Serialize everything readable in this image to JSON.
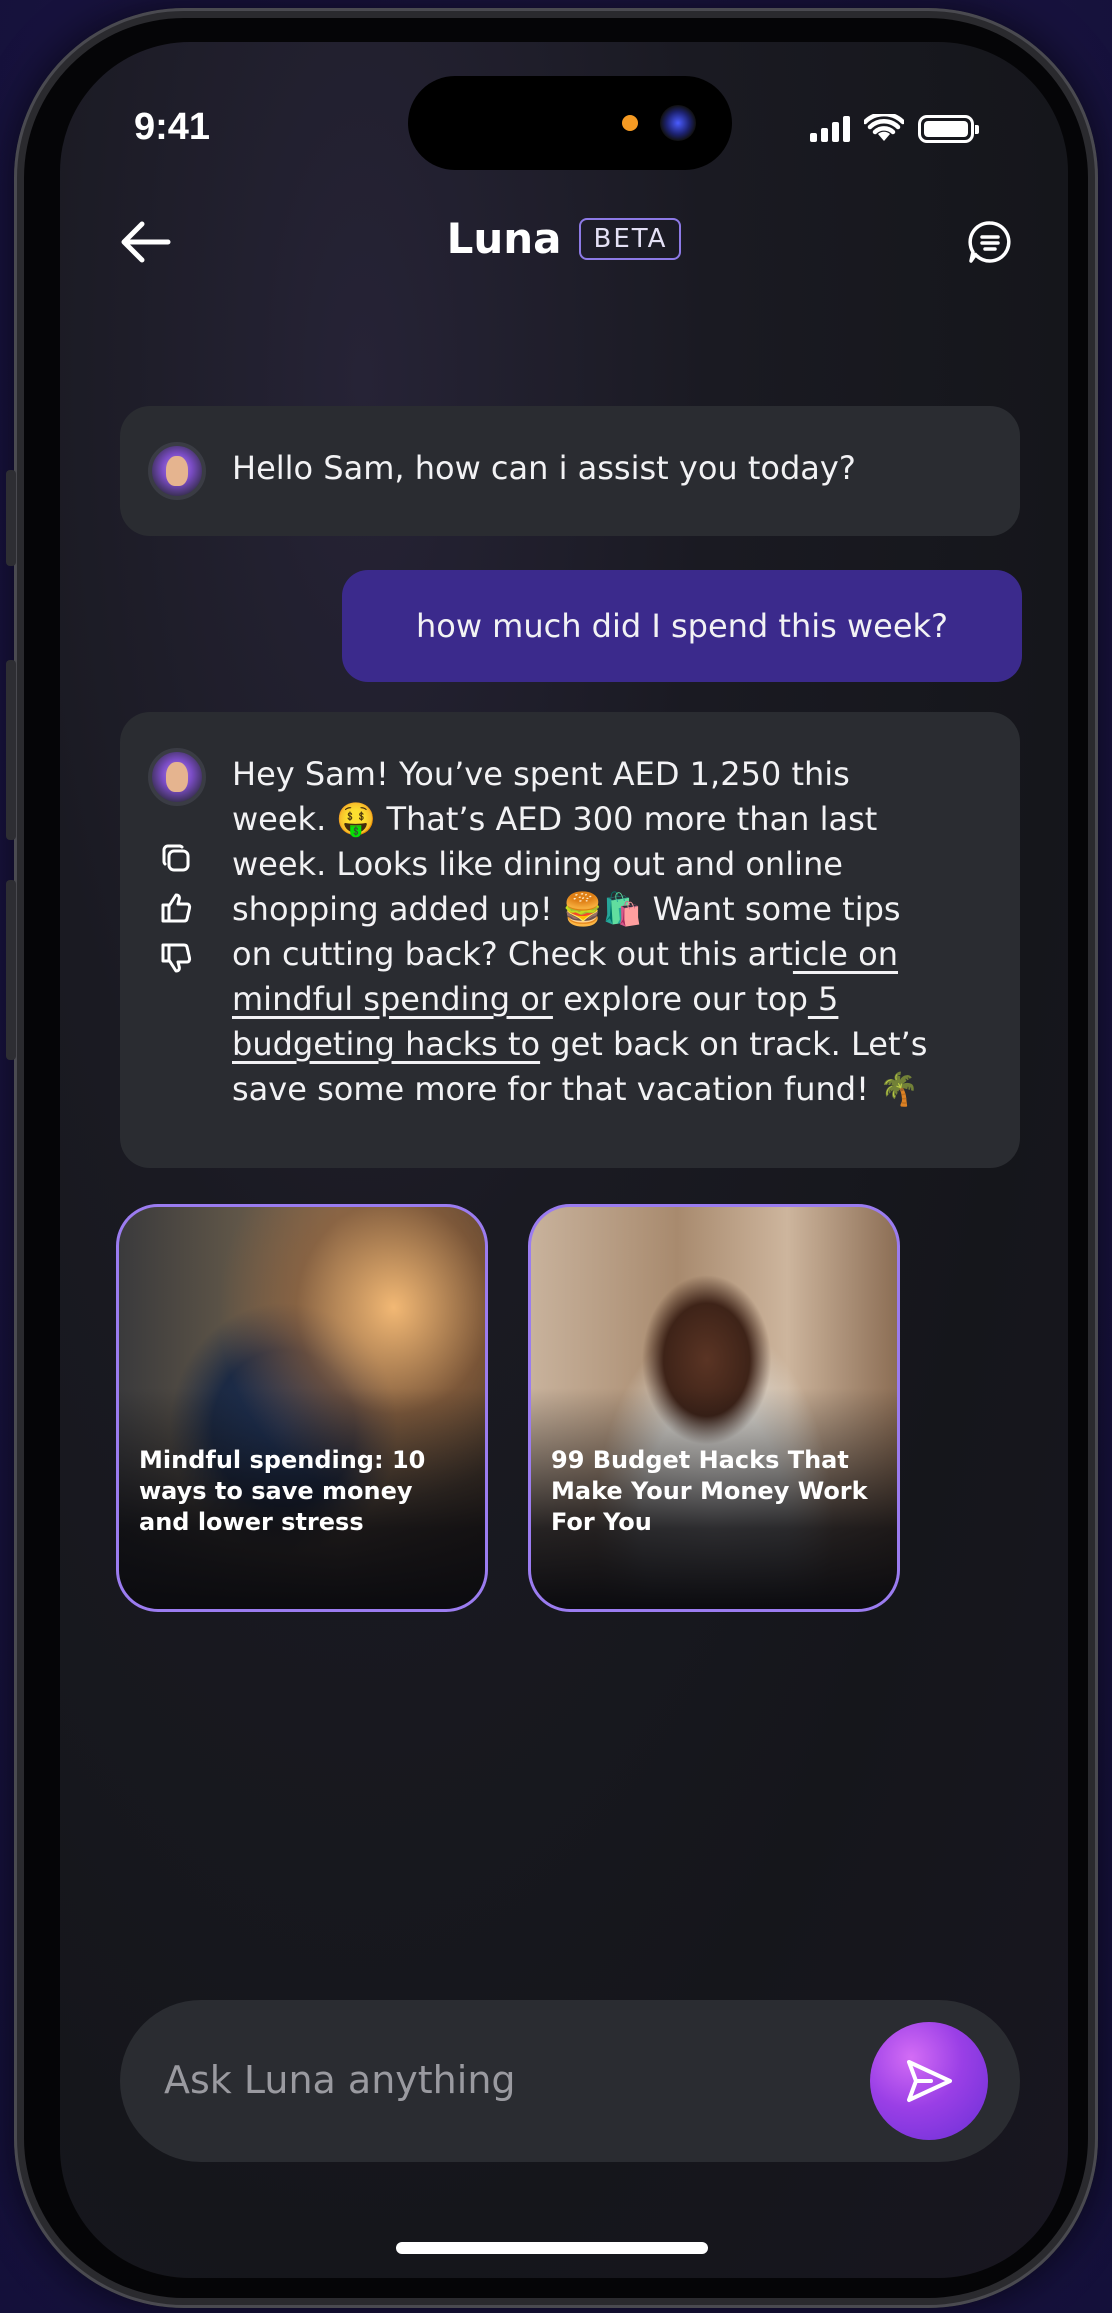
{
  "status_bar": {
    "time": "9:41"
  },
  "header": {
    "title": "Luna",
    "badge": "BETA"
  },
  "messages": {
    "bot_greeting": "Hello Sam, how can i assist you today?",
    "user_query": "how much did I spend this week?",
    "bot_reply": {
      "lines": [
        "Hey Sam! You’ve spent AED 1,250 this",
        "week. 🤑 That’s AED 300 more than last",
        "week. Looks like dining out and online",
        "shopping added up! 🍔🛍️ Want some tips",
        "on cutting back? Check out this art",
        "icle on",
        "mindful spending or",
        " explore our top",
        " 5",
        "budgeting hacks to",
        " get back on track. Let’s",
        "save some more for that vacation fund! 🌴"
      ]
    }
  },
  "cards": [
    {
      "title": "Mindful spending: 10 ways to save money and lower stress"
    },
    {
      "title": "99 Budget Hacks That Make Your Money Work For You"
    }
  ],
  "composer": {
    "placeholder": "Ask Luna anything"
  },
  "colors": {
    "accent": "#3b2a8c",
    "card_border": "#9b7cf0",
    "send_gradient": "#9a3fe6"
  }
}
